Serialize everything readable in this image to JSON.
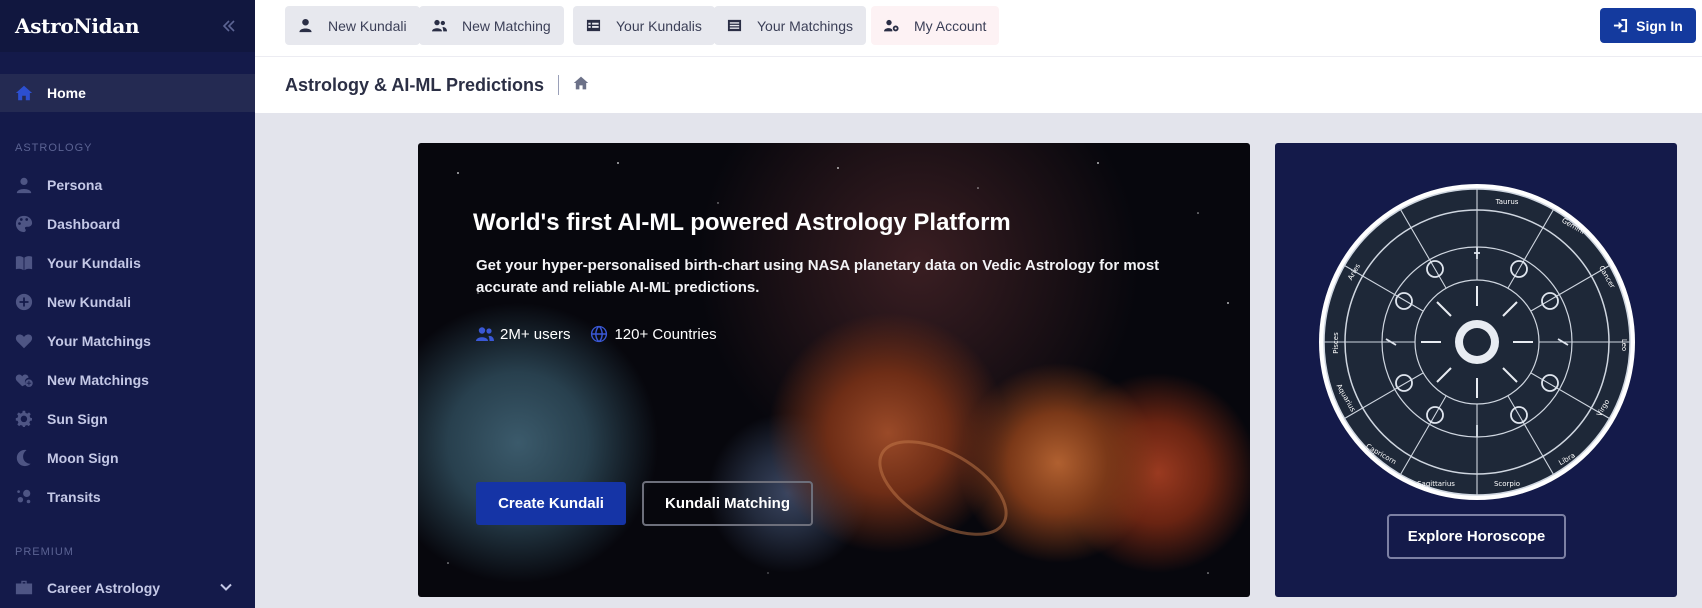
{
  "brand": {
    "name": "AstroNidan"
  },
  "sidebar": {
    "home_label": "Home",
    "section_astrology": "ASTROLOGY",
    "section_premium": "PREMIUM",
    "items": [
      {
        "label": "Persona",
        "icon": "person-icon"
      },
      {
        "label": "Dashboard",
        "icon": "palette-icon"
      },
      {
        "label": "Your Kundalis",
        "icon": "book-icon"
      },
      {
        "label": "New Kundali",
        "icon": "plus-circle-icon"
      },
      {
        "label": "Your Matchings",
        "icon": "heart-icon"
      },
      {
        "label": "New Matchings",
        "icon": "heart-plus-icon"
      },
      {
        "label": "Sun Sign",
        "icon": "sun-gear-icon"
      },
      {
        "label": "Moon Sign",
        "icon": "moon-icon"
      },
      {
        "label": "Transits",
        "icon": "planets-icon"
      }
    ],
    "premium_items": [
      {
        "label": "Career Astrology",
        "icon": "briefcase-icon"
      }
    ]
  },
  "topbar": {
    "buttons": [
      {
        "label": "New Kundali",
        "icon": "user-icon"
      },
      {
        "label": "New Matching",
        "icon": "users-icon"
      },
      {
        "label": "Your Kundalis",
        "icon": "table-icon"
      },
      {
        "label": "Your Matchings",
        "icon": "list-icon"
      },
      {
        "label": "My Account",
        "icon": "user-gear-icon"
      }
    ],
    "signin_label": "Sign In"
  },
  "subheader": {
    "title": "Astrology & AI-ML Predictions"
  },
  "hero": {
    "title": "World's first AI-ML powered Astrology Platform",
    "description": "Get your hyper-personalised birth-chart using NASA planetary data on Vedic Astrology for most accurate and reliable AI-ML predictions.",
    "stat_users": "2M+ users",
    "stat_countries": "120+ Countries",
    "primary_button": "Create Kundali",
    "secondary_button": "Kundali Matching"
  },
  "horoscope": {
    "button": "Explore Horoscope",
    "signs": [
      "Taurus",
      "Gemini",
      "Cancer",
      "Leo",
      "Virgo",
      "Libra",
      "Scorpio",
      "Sagittarius",
      "Capricorn",
      "Aquarius",
      "Pisces",
      "Aries"
    ]
  },
  "colors": {
    "sidebar_bg": "#141a4a",
    "accent_blue": "#143a9e",
    "page_bg": "#e3e4ec"
  }
}
